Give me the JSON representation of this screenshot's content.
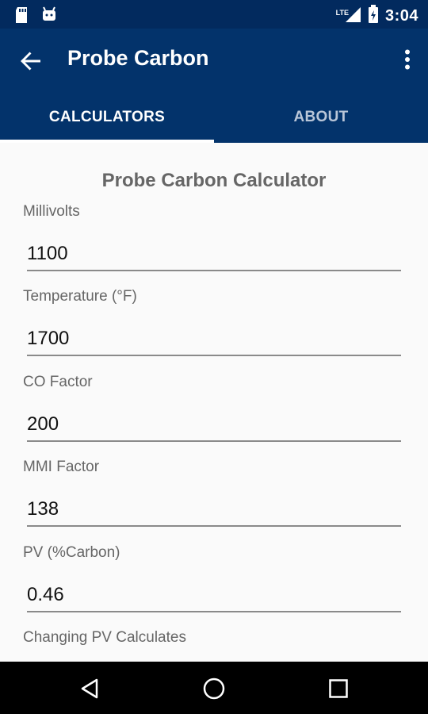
{
  "status_bar": {
    "time": "3:04",
    "network_label": "LTE",
    "icons": [
      "sd-card-icon",
      "android-icon",
      "signal-icon",
      "battery-icon"
    ]
  },
  "app_bar": {
    "title": "Probe Carbon"
  },
  "tabs": [
    {
      "label": "CALCULATORS",
      "active": true
    },
    {
      "label": "ABOUT",
      "active": false
    }
  ],
  "calculator": {
    "title": "Probe Carbon Calculator",
    "fields": [
      {
        "label": "Millivolts",
        "value": "1100"
      },
      {
        "label": "Temperature (°F)",
        "value": "1700"
      },
      {
        "label": "CO Factor",
        "value": "200"
      },
      {
        "label": "MMI Factor",
        "value": "138"
      },
      {
        "label": "PV (%Carbon)",
        "value": "0.46"
      }
    ],
    "footer_label": "Changing PV Calculates"
  },
  "colors": {
    "status_bar": "#022a5e",
    "app_bar": "#03336b",
    "background": "#fafafa",
    "label": "#666666"
  }
}
